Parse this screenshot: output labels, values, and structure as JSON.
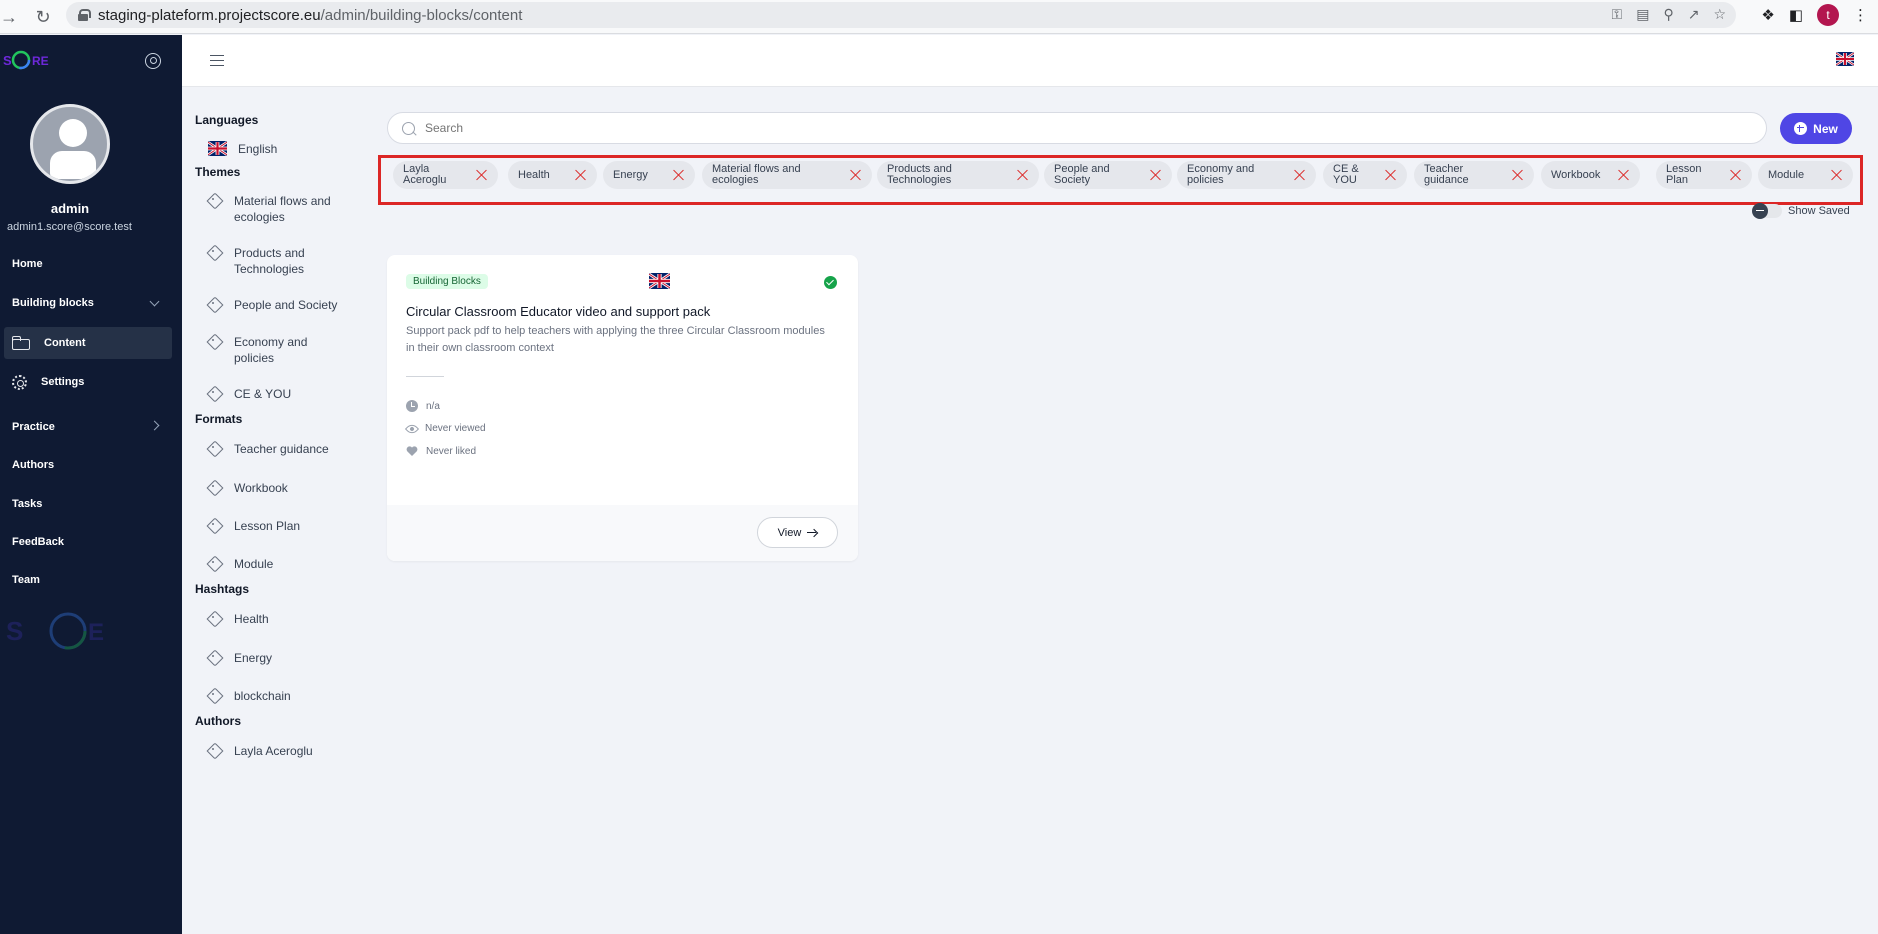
{
  "browser": {
    "url_host": "staging-plateform.projectscore.eu",
    "url_path": "/admin/building-blocks/content",
    "profile_initial": "t"
  },
  "sidebar": {
    "user_name": "admin",
    "user_email": "admin1.score@score.test",
    "items": [
      {
        "label": "Home"
      },
      {
        "label": "Building blocks"
      },
      {
        "label": "Content"
      },
      {
        "label": "Settings"
      },
      {
        "label": "Practice"
      },
      {
        "label": "Authors"
      },
      {
        "label": "Tasks"
      },
      {
        "label": "FeedBack"
      },
      {
        "label": "Team"
      }
    ]
  },
  "filters": {
    "languages_heading": "Languages",
    "language": "English",
    "themes_heading": "Themes",
    "themes": [
      "Material flows and ecologies",
      "Products and Technologies",
      "People and Society",
      "Economy and policies",
      "CE & YOU"
    ],
    "formats_heading": "Formats",
    "formats": [
      "Teacher guidance",
      "Workbook",
      "Lesson Plan",
      "Module"
    ],
    "hashtags_heading": "Hashtags",
    "hashtags": [
      "Health",
      "Energy",
      "blockchain"
    ],
    "authors_heading": "Authors",
    "authors": [
      "Layla Aceroglu"
    ]
  },
  "search": {
    "placeholder": "Search",
    "value": ""
  },
  "new_button": "New",
  "chips": [
    "Layla Aceroglu",
    "Health",
    "Energy",
    "Material flows and ecologies",
    "Products and Technologies",
    "People and Society",
    "Economy and policies",
    "CE & YOU",
    "Teacher guidance",
    "Workbook",
    "Lesson Plan",
    "Module"
  ],
  "show_saved": "Show Saved",
  "card": {
    "badge": "Building Blocks",
    "title": "Circular Classroom Educator video and support pack",
    "description": "Support pack pdf to help teachers with applying the three Circular Classroom modules in their own classroom context",
    "duration": "n/a",
    "views": "Never viewed",
    "likes": "Never liked",
    "view_button": "View"
  },
  "colors": {
    "sidebar_bg": "#0f1a33",
    "accent": "#4f46e5",
    "chip_remove": "#dc2626",
    "highlight_border": "#dc2626",
    "badge_bg": "#dcfce7",
    "status_ok": "#16a34a"
  }
}
